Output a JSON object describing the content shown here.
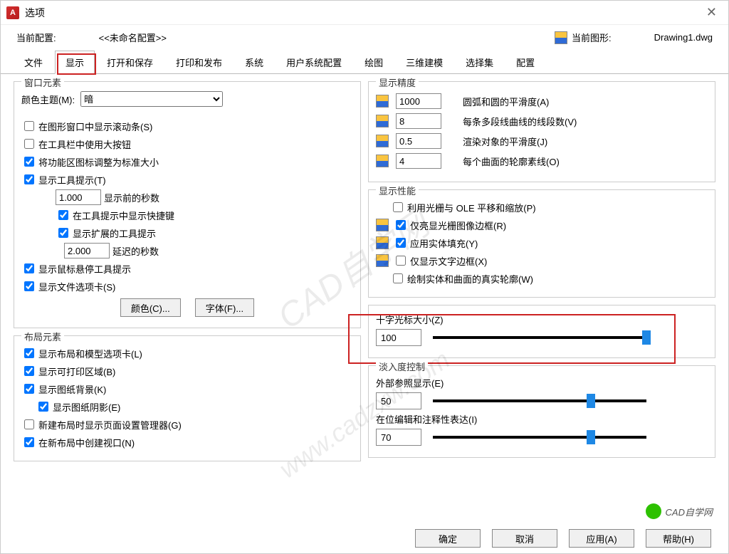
{
  "window": {
    "title": "选项"
  },
  "profile": {
    "current_profile_label": "当前配置:",
    "current_profile_value": "<<未命名配置>>",
    "current_drawing_label": "当前图形:",
    "current_drawing_value": "Drawing1.dwg"
  },
  "tabs": [
    "文件",
    "显示",
    "打开和保存",
    "打印和发布",
    "系统",
    "用户系统配置",
    "绘图",
    "三维建模",
    "选择集",
    "配置"
  ],
  "active_tab_index": 1,
  "window_elements": {
    "legend": "窗口元素",
    "color_theme_label": "颜色主题(M):",
    "color_theme_value": "暗",
    "scrollbar": "在图形窗口中显示滚动条(S)",
    "big_buttons": "在工具栏中使用大按钮",
    "ribbon_std": "将功能区图标调整为标准大小",
    "show_tooltip": "显示工具提示(T)",
    "tooltip_sec_value": "1.000",
    "tooltip_sec_label": "显示前的秒数",
    "shortcut_in_tooltip": "在工具提示中显示快捷键",
    "ext_tooltip": "显示扩展的工具提示",
    "delay_value": "2.000",
    "delay_label": "延迟的秒数",
    "show_hover": "显示鼠标悬停工具提示",
    "show_file_tabs": "显示文件选项卡(S)",
    "btn_colors": "颜色(C)...",
    "btn_fonts": "字体(F)..."
  },
  "layout_elements": {
    "legend": "布局元素",
    "show_layout_tabs": "显示布局和模型选项卡(L)",
    "show_printable": "显示可打印区域(B)",
    "show_paper_bg": "显示图纸背景(K)",
    "show_paper_shadow": "显示图纸阴影(E)",
    "show_page_setup": "新建布局时显示页面设置管理器(G)",
    "create_vp": "在新布局中创建视口(N)"
  },
  "precision": {
    "legend": "显示精度",
    "arc_value": "1000",
    "arc_label": "圆弧和圆的平滑度(A)",
    "seg_value": "8",
    "seg_label": "每条多段线曲线的线段数(V)",
    "render_value": "0.5",
    "render_label": "渲染对象的平滑度(J)",
    "contour_value": "4",
    "contour_label": "每个曲面的轮廓素线(O)"
  },
  "performance": {
    "legend": "显示性能",
    "raster_ole": "利用光栅与 OLE 平移和缩放(P)",
    "highlight_frame": "仅亮显光栅图像边框(R)",
    "solid_fill": "应用实体填充(Y)",
    "text_frame": "仅显示文字边框(X)",
    "true_silhouette": "绘制实体和曲面的真实轮廓(W)"
  },
  "crosshair": {
    "legend": "十字光标大小(Z)",
    "value": "100"
  },
  "fade": {
    "legend": "淡入度控制",
    "xref_label": "外部参照显示(E)",
    "xref_value": "50",
    "inplace_label": "在位编辑和注释性表达(I)",
    "inplace_value": "70"
  },
  "buttons": {
    "ok": "确定",
    "cancel": "取消",
    "apply": "应用(A)",
    "help": "帮助(H)"
  },
  "watermark": "CAD自学网"
}
